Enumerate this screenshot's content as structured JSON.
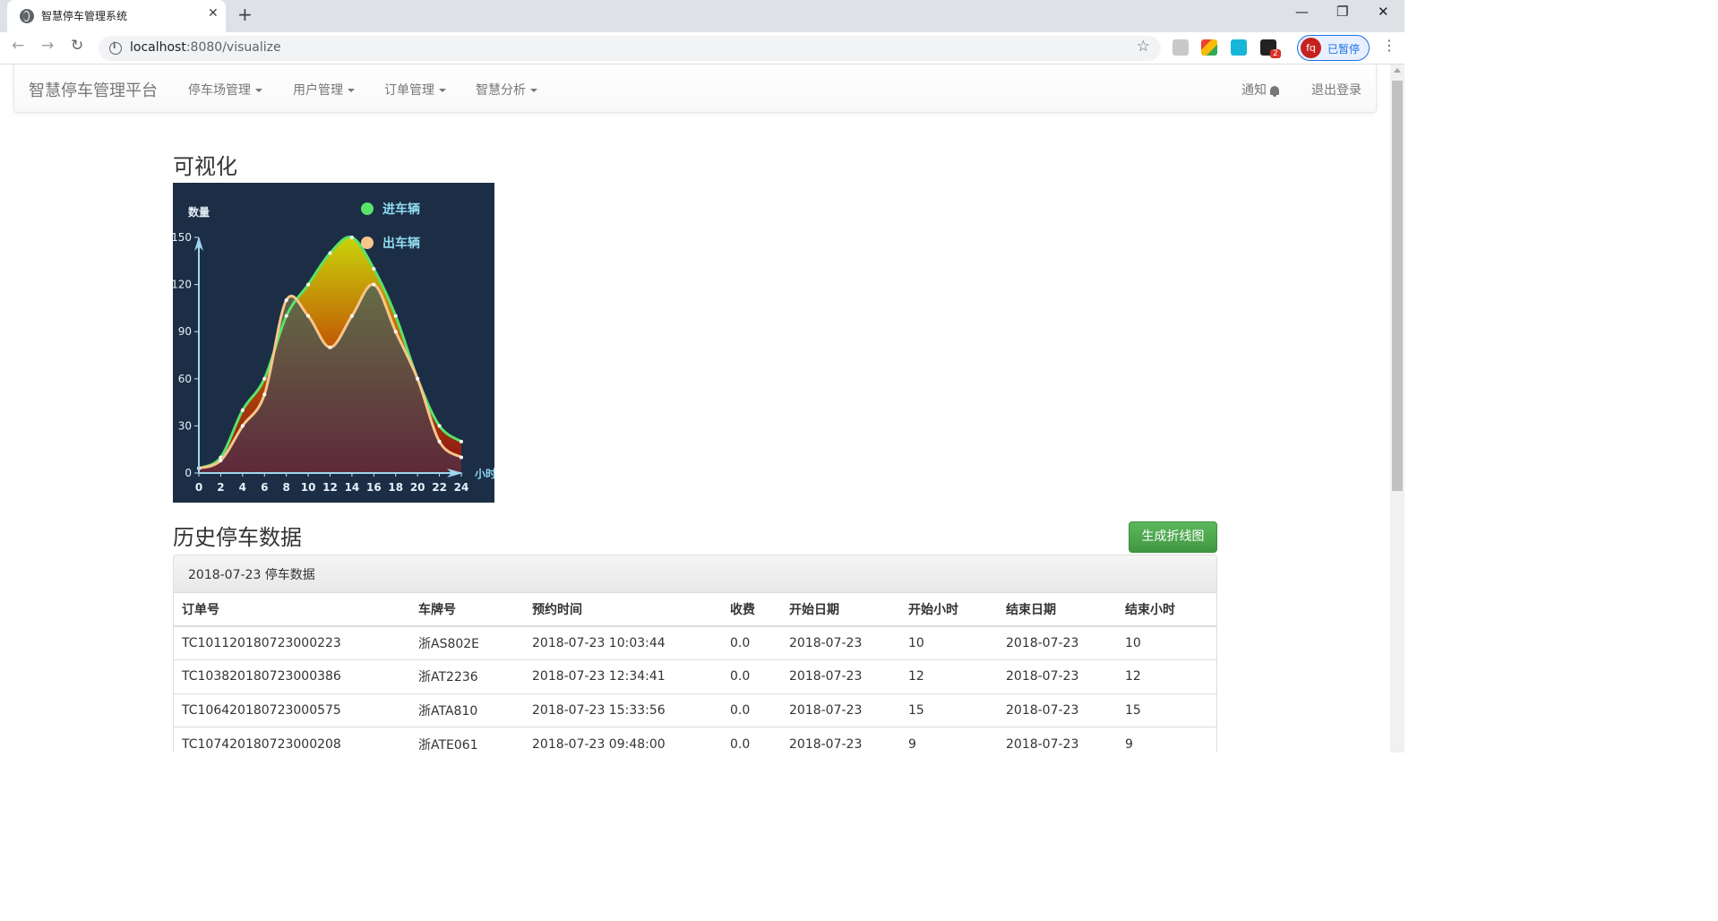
{
  "browser": {
    "tab_title": "智慧停车管理系统",
    "url_host": "localhost",
    "url_path": ":8080/visualize",
    "profile_initials": "fq",
    "profile_label": "已暂停",
    "extension_badge": "2"
  },
  "navbar": {
    "brand": "智慧停车管理平台",
    "menus": [
      "停车场管理",
      "用户管理",
      "订单管理",
      "智慧分析"
    ],
    "notify": "通知",
    "logout": "退出登录"
  },
  "page": {
    "viz_title": "可视化",
    "history_title": "历史停车数据",
    "generate_button": "生成折线图",
    "panel_title": "2018-07-23 停车数据"
  },
  "chart_data": {
    "type": "area",
    "ylabel": "数量",
    "xlabel": "小时",
    "x": [
      0,
      2,
      4,
      6,
      8,
      10,
      12,
      14,
      16,
      18,
      20,
      22,
      24
    ],
    "xlim": [
      0,
      24
    ],
    "ylim": [
      0,
      150
    ],
    "yticks": [
      0,
      30,
      60,
      90,
      120,
      150
    ],
    "background": "#1c2e46",
    "legend_position": "top-right",
    "series": [
      {
        "name": "进车辆",
        "color": "#59e36a",
        "values": [
          3,
          10,
          40,
          60,
          100,
          120,
          140,
          150,
          130,
          100,
          60,
          30,
          20
        ]
      },
      {
        "name": "出车辆",
        "color": "#f8c58a",
        "values": [
          3,
          8,
          30,
          50,
          110,
          100,
          80,
          100,
          120,
          90,
          60,
          20,
          10
        ]
      }
    ]
  },
  "table": {
    "headers": [
      "订单号",
      "车牌号",
      "预约时间",
      "收费",
      "开始日期",
      "开始小时",
      "结束日期",
      "结束小时"
    ],
    "rows": [
      [
        "TC101120180723000223",
        "浙AS802E",
        "2018-07-23 10:03:44",
        "0.0",
        "2018-07-23",
        "10",
        "2018-07-23",
        "10"
      ],
      [
        "TC103820180723000386",
        "浙AT2236",
        "2018-07-23 12:34:41",
        "0.0",
        "2018-07-23",
        "12",
        "2018-07-23",
        "12"
      ],
      [
        "TC106420180723000575",
        "浙ATA810",
        "2018-07-23 15:33:56",
        "0.0",
        "2018-07-23",
        "15",
        "2018-07-23",
        "15"
      ],
      [
        "TC107420180723000208",
        "浙ATE061",
        "2018-07-23 09:48:00",
        "0.0",
        "2018-07-23",
        "9",
        "2018-07-23",
        "9"
      ]
    ]
  }
}
